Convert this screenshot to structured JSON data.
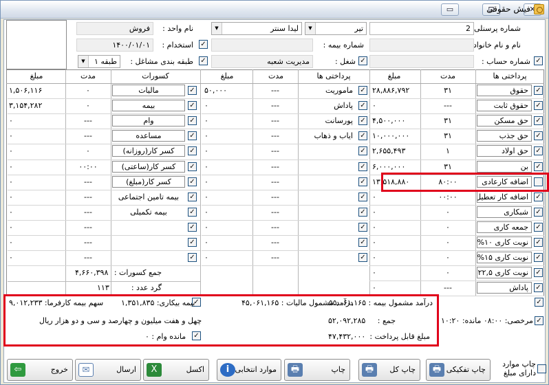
{
  "window": {
    "title": "فیش حقوقی",
    "controls": {
      "minimize": "▭",
      "maximize": "⊡",
      "close": "✕"
    }
  },
  "header": {
    "personnel_no_label": "شماره پرسنلی :",
    "personnel_no": "2",
    "month": "تیر",
    "company": "لیدا سنتر",
    "unit_label": "نام واحد :",
    "unit": "فروش",
    "fullname_label": "نام و نام خانوادگی :",
    "fullname": "",
    "insurance_no_label": "شماره بیمه :",
    "insurance_no": "",
    "hire_label": "استخدام :",
    "hire_date": "۱۴۰۰/۰۱/۰۱",
    "account_label": "شماره حساب :",
    "account": "",
    "job_label": "شغل :",
    "job": "مدیریت شعبه",
    "class_label": "طبقه بندی مشاغل :",
    "class_value": "طبقه ۱"
  },
  "columns": {
    "payments": "پرداختی ها",
    "duration": "مدت",
    "amount": "مبلغ",
    "deductions": "کسورات"
  },
  "payments": [
    {
      "name": "حقوق",
      "checked": true,
      "duration": "۳۱",
      "amount": "۲۸,۸۸۶,۷۹۲"
    },
    {
      "name": "حقوق ثابت",
      "checked": true,
      "duration": "---",
      "amount": "۰"
    },
    {
      "name": "حق مسکن",
      "checked": true,
      "duration": "۳۱",
      "amount": "۴,۵۰۰,۰۰۰"
    },
    {
      "name": "حق جذب",
      "checked": true,
      "duration": "۳۱",
      "amount": "۱۰,۰۰۰,۰۰۰"
    },
    {
      "name": "حق اولاد",
      "checked": true,
      "duration": "۱",
      "amount": "۲,۶۵۵,۴۹۳"
    },
    {
      "name": "بن",
      "checked": true,
      "duration": "۳۱",
      "amount": "۶,۰۰۰,۰۰۰"
    },
    {
      "name": "اضافه کارعادی",
      "checked": false,
      "duration": "۸۰:۰۰",
      "amount": "۱۳,۵۱۸,۸۸۰"
    },
    {
      "name": "اضافه کار تعطیل",
      "checked": true,
      "duration": "۰۰:۰۰",
      "amount": "۰"
    },
    {
      "name": "شبکاری",
      "checked": true,
      "duration": "۰",
      "amount": "۰"
    },
    {
      "name": "جمعه کاری",
      "checked": true,
      "duration": "۰",
      "amount": "۰"
    },
    {
      "name": "نوبت کاری ۱۰%",
      "checked": true,
      "duration": "۰",
      "amount": "۰"
    },
    {
      "name": "نوبت کاری ۱۵%",
      "checked": true,
      "duration": "۰",
      "amount": "۰"
    },
    {
      "name": "نوبت کاری ۲۲,۵%",
      "checked": true,
      "duration": "۰",
      "amount": "۰"
    },
    {
      "name": "پاداش",
      "checked": true,
      "duration": "---",
      "amount": "۰"
    }
  ],
  "payments2": [
    {
      "name": "ماموریت",
      "checked": true,
      "duration": "---",
      "amount": "۵۰,۰۰۰"
    },
    {
      "name": "پاداش",
      "checked": true,
      "duration": "---",
      "amount": "۰"
    },
    {
      "name": "پورسانت",
      "checked": true,
      "duration": "---",
      "amount": "۰"
    },
    {
      "name": "ایاب و ذهاب",
      "checked": true,
      "duration": "---",
      "amount": "۰"
    },
    {
      "name": "",
      "checked": true,
      "duration": "---",
      "amount": "۰"
    },
    {
      "name": "",
      "checked": true,
      "duration": "---",
      "amount": "۰"
    },
    {
      "name": "",
      "checked": true,
      "duration": "---",
      "amount": "۰"
    },
    {
      "name": "",
      "checked": true,
      "duration": "---",
      "amount": "۰"
    },
    {
      "name": "",
      "checked": true,
      "duration": "---",
      "amount": "۰"
    },
    {
      "name": "",
      "checked": true,
      "duration": "---",
      "amount": "۰"
    },
    {
      "name": "",
      "checked": true,
      "duration": "---",
      "amount": "۰"
    },
    {
      "name": "",
      "checked": true,
      "duration": "---",
      "amount": "۰"
    }
  ],
  "deductions": [
    {
      "name": "مالیات",
      "checked": true,
      "duration": "۰",
      "amount": "۱,۵۰۶,۱۱۶",
      "boxed": true
    },
    {
      "name": "بیمه",
      "checked": true,
      "duration": "۰",
      "amount": "۳,۱۵۴,۲۸۲",
      "boxed": true
    },
    {
      "name": "وام",
      "checked": true,
      "duration": "---",
      "amount": "۰",
      "boxed": true
    },
    {
      "name": "مساعده",
      "checked": true,
      "duration": "---",
      "amount": "۰",
      "boxed": true
    },
    {
      "name": "کسر کار(روزانه)",
      "checked": true,
      "duration": "۰",
      "amount": "۰",
      "boxed": true
    },
    {
      "name": "کسر کار(ساعتی)",
      "checked": true,
      "duration": "۰۰:۰۰",
      "amount": "۰",
      "boxed": true
    },
    {
      "name": "کسر کار(مبلغ)",
      "checked": true,
      "duration": "---",
      "amount": "۰",
      "boxed": true
    },
    {
      "name": "بیمه تامین اجتماعی",
      "checked": true,
      "duration": "---",
      "amount": "۰",
      "boxed": false
    },
    {
      "name": "بیمه تکمیلی",
      "checked": true,
      "duration": "---",
      "amount": "۰",
      "boxed": false
    },
    {
      "name": "",
      "checked": true,
      "duration": "---",
      "amount": "۰",
      "boxed": false
    },
    {
      "name": "",
      "checked": true,
      "duration": "---",
      "amount": "۰",
      "boxed": false
    },
    {
      "name": "",
      "checked": true,
      "duration": "---",
      "amount": "۰",
      "boxed": false
    }
  ],
  "totals": {
    "deductions_label": "جمع کسورات :",
    "deductions_value": "۴,۶۶۰,۳۹۸",
    "rounding_label": "گرد عدد :",
    "rounding_value": "۱۱۳"
  },
  "summary": {
    "insurable_income": "درآمد مشمول بیمه : ۵۵,۰۶۱,۱۶۵",
    "taxable_income": "درآمد مشمول مالیات : ۴۵,۰۶۱,۱۶۵",
    "unemployment": "بیمه بیکاری: ۱,۳۵۱,۸۳۵",
    "employer_share": "سهم بیمه کارفرما: ۹,۰۱۲,۲۳۳",
    "leave": "مرخصی: ۰۸:۰۰ مانده: ۱۰:۲۰",
    "total_label": "جمع :",
    "total_value": "۵۲,۰۹۲,۲۸۵",
    "words": "چهل و هفت میلیون و چهارصد و سی و دو هزار ریال",
    "payable_label": "مبلغ قابل پرداخت :",
    "payable_value": "۴۷,۴۳۲,۰۰۰",
    "loan_remaining": "مانده وام : ۰"
  },
  "buttons": {
    "print_with_amount": "چاپ موارد دارای مبلغ",
    "print_separate": "چاپ تفکیکی",
    "print_all": "چاپ کل",
    "print": "چاپ",
    "selected_items": "موارد انتخابی",
    "excel": "اکسل",
    "send": "ارسال",
    "exit": "خروج"
  },
  "icons": {
    "printer": "🖶",
    "info": "i",
    "excel": "X",
    "mail": "✉",
    "exit": "⇦"
  },
  "colors": {
    "highlight": "#e0001b",
    "accent_blue": "#1c5180"
  }
}
